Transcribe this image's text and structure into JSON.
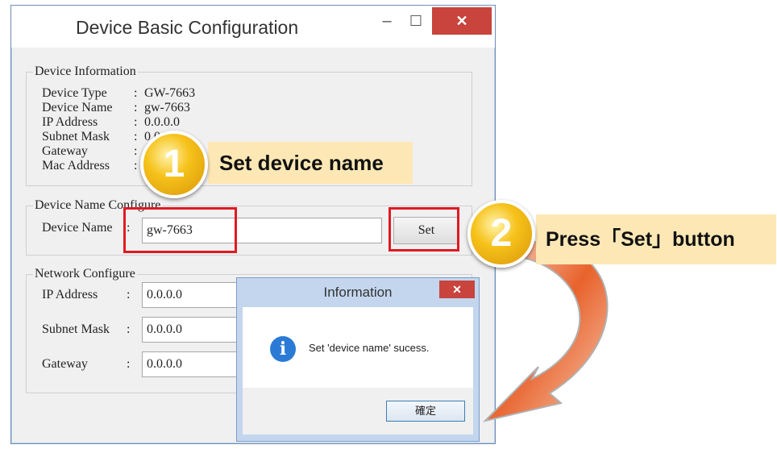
{
  "window": {
    "title": "Device Basic Configuration",
    "minimize_glyph": "–",
    "maximize_glyph": "☐",
    "close_glyph": "✕"
  },
  "device_info": {
    "group_label": "Device Information",
    "rows": [
      {
        "label": "Device Type",
        "sep": ":",
        "value": "GW-7663"
      },
      {
        "label": "Device Name",
        "sep": ":",
        "value": "gw-7663"
      },
      {
        "label": "IP Address",
        "sep": ":",
        "value": "0.0.0.0"
      },
      {
        "label": "Subnet Mask",
        "sep": ":",
        "value": "0.0"
      },
      {
        "label": "Gateway",
        "sep": ":",
        "value": ""
      },
      {
        "label": "Mac Address",
        "sep": ":",
        "value": ""
      }
    ]
  },
  "name_config": {
    "group_label": "Device Name Configure",
    "field_label": "Device Name",
    "sep": ":",
    "value": "gw-7663",
    "set_button": "Set"
  },
  "network_config": {
    "group_label": "Network Configure",
    "ip_label": "IP Address",
    "ip_value": "0.0.0.0",
    "mask_label": "Subnet Mask",
    "mask_value": "0.0.0.0",
    "gateway_label": "Gateway",
    "gateway_value": "0.0.0.0",
    "sep": ":"
  },
  "info_dialog": {
    "title": "Information",
    "close_glyph": "✕",
    "icon_glyph": "i",
    "message": "Set 'device name' sucess.",
    "ok_button": "確定"
  },
  "callouts": {
    "step1_number": "1",
    "step1_text": "Set device name",
    "step2_number": "2",
    "step2_text": "Press「Set」button"
  },
  "colors": {
    "highlight_red": "#e01a22",
    "callout_bg": "#fde8b5",
    "badge_gold": "#f6c21a",
    "arrow_orange": "#e8622c",
    "close_red": "#c8443c"
  },
  "icons": {
    "info": "info-icon",
    "arrow": "curved-arrow-icon"
  }
}
